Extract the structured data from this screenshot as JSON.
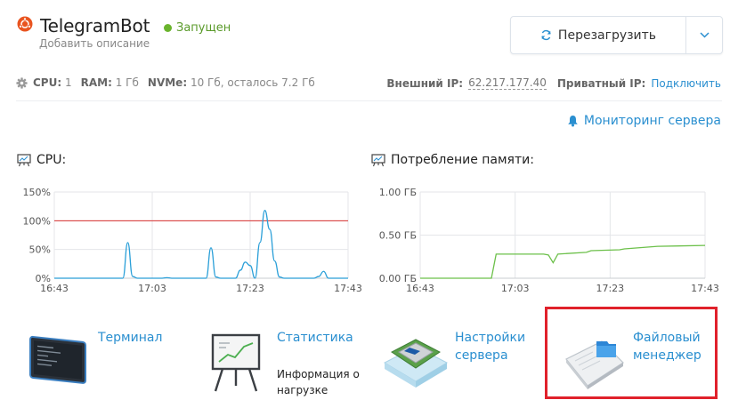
{
  "server": {
    "name": "TelegramBot",
    "status": "Запущен",
    "description": "Добавить описание",
    "restart_label": "Перезагрузить"
  },
  "specs": {
    "cpu_label": "CPU:",
    "cpu_value": "1",
    "ram_label": "RAM:",
    "ram_value": "1 Гб",
    "nvme_label": "NVMe:",
    "nvme_value": "10 Гб, осталось 7.2 Гб"
  },
  "network": {
    "external_ip_label": "Внешний IP:",
    "external_ip": "62.217.177.40",
    "private_ip_label": "Приватный IP:",
    "private_ip_action": "Подключить"
  },
  "monitoring_label": "Мониторинг сервера",
  "colors": {
    "accent": "#2a8fd0",
    "running": "#6ab42d",
    "cpu_line": "#2a9fd8",
    "mem_line": "#6cc04a",
    "limit": "#d9302f"
  },
  "chart_data": [
    {
      "type": "line",
      "title": "CPU:",
      "x_ticks": [
        "16:43",
        "17:03",
        "17:23",
        "17:43"
      ],
      "y_ticks": [
        "150%",
        "100%",
        "50%",
        "0%"
      ],
      "ylim": [
        0,
        150
      ],
      "threshold": 100,
      "series": [
        {
          "x": [
            0,
            13,
            14,
            15,
            16,
            17,
            18,
            22,
            23,
            24,
            25,
            26,
            27,
            29,
            30,
            31,
            32,
            33,
            34,
            35,
            36,
            37,
            38,
            39,
            40,
            41,
            42,
            43,
            44,
            45,
            46,
            47,
            48,
            53,
            54,
            55,
            56,
            60
          ],
          "values": [
            0,
            0,
            0,
            62,
            3,
            0,
            0,
            0,
            1,
            0,
            0,
            0,
            0,
            0,
            0,
            0,
            53,
            2,
            0,
            0,
            0,
            0,
            14,
            28,
            22,
            0,
            62,
            118,
            85,
            30,
            2,
            0,
            0,
            0,
            3,
            12,
            0,
            0
          ]
        }
      ]
    },
    {
      "type": "area",
      "title": "Потребление памяти:",
      "x_ticks": [
        "16:43",
        "17:03",
        "17:23",
        "17:43"
      ],
      "y_ticks": [
        "1.00 ГБ",
        "0.50 ГБ",
        "0.00 ГБ"
      ],
      "ylim": [
        0,
        1
      ],
      "series": [
        {
          "x": [
            0,
            15,
            16,
            18,
            26,
            27,
            28,
            29,
            35,
            36,
            42,
            43,
            50,
            60
          ],
          "values": [
            0,
            0,
            0.28,
            0.28,
            0.28,
            0.27,
            0.18,
            0.28,
            0.3,
            0.32,
            0.33,
            0.34,
            0.37,
            0.38
          ]
        }
      ]
    }
  ],
  "tiles": [
    {
      "label": "Терминал",
      "icon": "terminal-icon"
    },
    {
      "label": "Статистика",
      "sub": "Информация о нагрузке",
      "icon": "statistics-icon"
    },
    {
      "label": "Настройки сервера",
      "icon": "cpu-chip-icon"
    },
    {
      "label": "Файловый менеджер",
      "icon": "file-manager-icon"
    }
  ]
}
